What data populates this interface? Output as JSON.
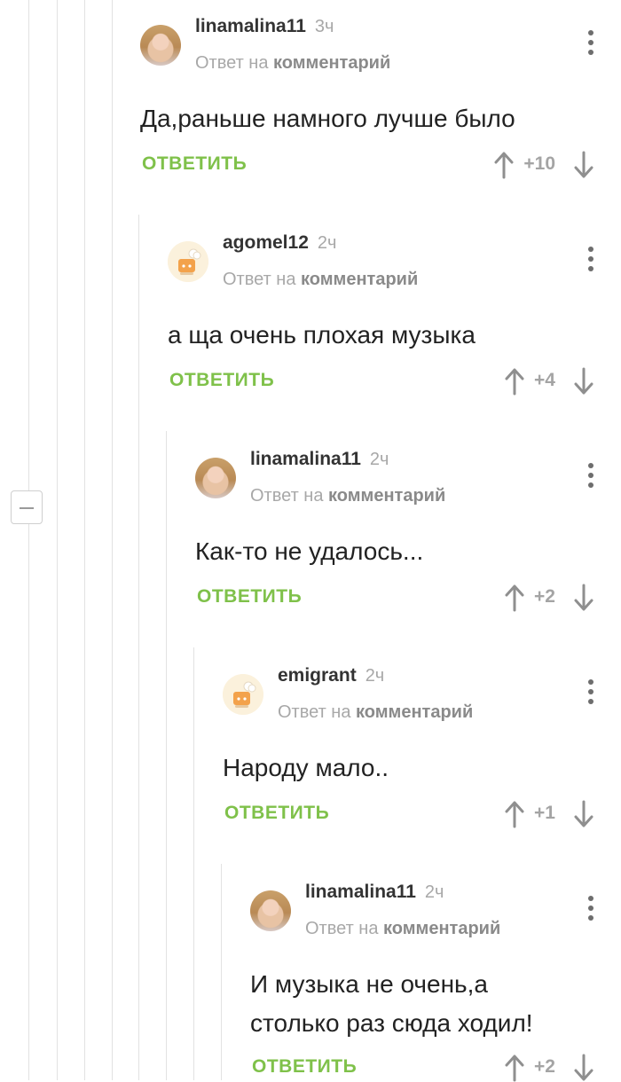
{
  "comments": [
    {
      "author": "linamalina11",
      "time": "3ч",
      "reply_prefix": "Ответ на",
      "reply_link": "комментарий",
      "text": "Да,раньше намного лучше было",
      "reply_label": "ОТВЕТИТЬ",
      "rating": "+10",
      "avatar": "user-photo"
    },
    {
      "author": "agomel12",
      "time": "2ч",
      "reply_prefix": "Ответ на",
      "reply_link": "комментарий",
      "text": "а ща очень плохая музыка",
      "reply_label": "ОТВЕТИТЬ",
      "rating": "+4",
      "avatar": "default-cook"
    },
    {
      "author": "linamalina11",
      "time": "2ч",
      "reply_prefix": "Ответ на",
      "reply_link": "комментарий",
      "text": "Как-то не удалось...",
      "reply_label": "ОТВЕТИТЬ",
      "rating": "+2",
      "avatar": "user-photo"
    },
    {
      "author": "emigrant",
      "time": "2ч",
      "reply_prefix": "Ответ на",
      "reply_link": "комментарий",
      "text": "Народу мало..",
      "reply_label": "ОТВЕТИТЬ",
      "rating": "+1",
      "avatar": "default-cook"
    },
    {
      "author": "linamalina11",
      "time": "2ч",
      "reply_prefix": "Ответ на",
      "reply_link": "комментарий",
      "text": "И музыка не очень,а столько раз сюда ходил!",
      "reply_label": "ОТВЕТИТЬ",
      "rating": "+2",
      "avatar": "user-photo"
    }
  ],
  "colors": {
    "accent_green": "#7fc14a",
    "thread_line": "#e2e2e2",
    "muted_text": "#a8a8a8"
  },
  "icons": [
    "collapse-icon",
    "kebab-menu-icon",
    "arrow-up-icon",
    "arrow-down-icon"
  ]
}
